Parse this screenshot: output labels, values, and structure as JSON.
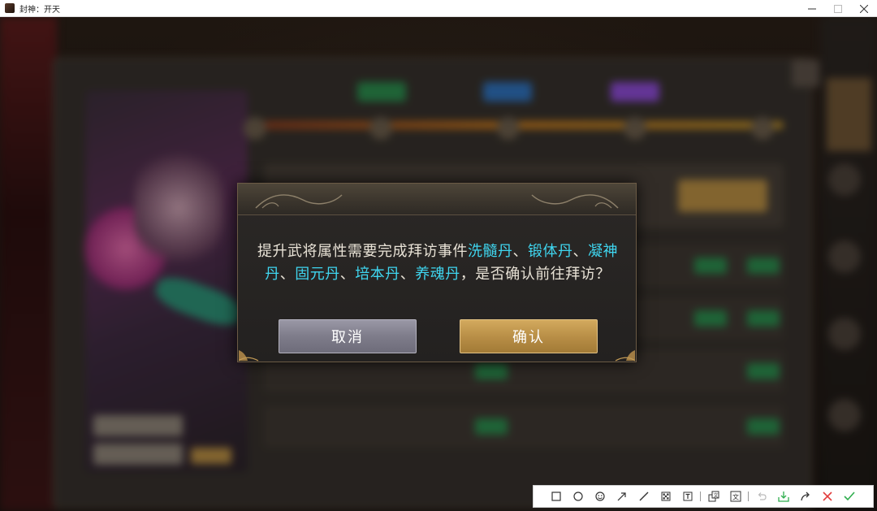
{
  "window": {
    "title": "封神：开天",
    "controls": [
      {
        "name": "minimize-button",
        "glyph": "—"
      },
      {
        "name": "maximize-button",
        "glyph": "☐"
      },
      {
        "name": "close-window-button",
        "glyph": "✕"
      }
    ]
  },
  "dialog": {
    "message_parts": [
      {
        "text": "提升武将属性需要完成拜访事件",
        "highlight": false
      },
      {
        "text": "洗髓丹",
        "highlight": true
      },
      {
        "text": "、",
        "highlight": false
      },
      {
        "text": "锻体丹",
        "highlight": true
      },
      {
        "text": "、",
        "highlight": false
      },
      {
        "text": "凝神丹",
        "highlight": true
      },
      {
        "text": "、",
        "highlight": false
      },
      {
        "text": "固元丹",
        "highlight": true
      },
      {
        "text": "、",
        "highlight": false
      },
      {
        "text": "培本丹",
        "highlight": true
      },
      {
        "text": "、",
        "highlight": false
      },
      {
        "text": "养魂丹",
        "highlight": true
      },
      {
        "text": "，是否确认前往拜访？",
        "highlight": false
      }
    ],
    "cancel_label": "取消",
    "confirm_label": "确认",
    "highlight_color": "#3fd6f0"
  },
  "toolbar": {
    "tools": [
      {
        "name": "rectangle-tool-icon"
      },
      {
        "name": "ellipse-tool-icon"
      },
      {
        "name": "emoji-tool-icon"
      },
      {
        "name": "arrow-tool-icon"
      },
      {
        "name": "line-tool-icon"
      },
      {
        "name": "mosaic-tool-icon"
      },
      {
        "name": "text-tool-icon"
      },
      {
        "name": "separator"
      },
      {
        "name": "ocr-tool-icon"
      },
      {
        "name": "translate-tool-icon"
      },
      {
        "name": "separator"
      },
      {
        "name": "undo-icon"
      },
      {
        "name": "save-icon"
      },
      {
        "name": "share-icon"
      },
      {
        "name": "cancel-icon"
      },
      {
        "name": "done-icon"
      }
    ]
  }
}
